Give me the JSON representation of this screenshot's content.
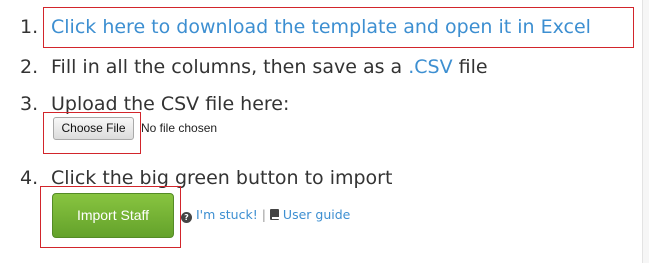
{
  "steps": {
    "step1": {
      "number": "1.",
      "link_text": "Click here to download the template and open it in Excel"
    },
    "step2": {
      "number": "2.",
      "text_before": "Fill in all the columns, then save as a",
      "link_text": ".CSV",
      "text_after": "file"
    },
    "step3": {
      "number": "3.",
      "text": "Upload the CSV file here:",
      "file_button_label": "Choose File",
      "file_status": "No file chosen"
    },
    "step4": {
      "number": "4.",
      "text": "Click the big green button to import",
      "import_button_label": "Import Staff",
      "help_icon": "question-circle-icon",
      "stuck_link": "I'm stuck!",
      "separator": "|",
      "guide_icon": "book-icon",
      "guide_link": "User guide"
    }
  },
  "colors": {
    "link": "#3d8fd1",
    "import_button": "#75b235",
    "highlight_border": "#d2252b",
    "text": "#333333"
  }
}
